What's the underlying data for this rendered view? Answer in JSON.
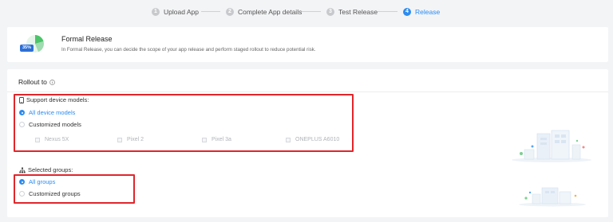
{
  "stepper": {
    "steps": [
      {
        "num": "1",
        "label": "Upload App"
      },
      {
        "num": "2",
        "label": "Complete App details"
      },
      {
        "num": "3",
        "label": "Test Release"
      },
      {
        "num": "4",
        "label": "Release"
      }
    ],
    "active_color": "#2d8cf0"
  },
  "header": {
    "icon_badge": "35%",
    "title": "Formal Release",
    "description": "In Formal Release, you can decide the scope of your app release and perform staged rollout to reduce potential risk."
  },
  "rollout": {
    "title": "Rollout to",
    "device_section": {
      "title": "Support device models:",
      "options": [
        {
          "label": "All device models",
          "selected": true
        },
        {
          "label": "Customized models",
          "selected": false
        }
      ],
      "models": [
        "Nexus 5X",
        "Pixel 2",
        "Pixel 3a",
        "ONEPLUS A6010"
      ]
    },
    "group_section": {
      "title": "Selected groups:",
      "options": [
        {
          "label": "All groups",
          "selected": true
        },
        {
          "label": "Customized groups",
          "selected": false
        }
      ]
    }
  },
  "colors": {
    "accent": "#2d8cf0",
    "highlight_box": "#e0262b",
    "page_bg": "#f3f4f6"
  }
}
